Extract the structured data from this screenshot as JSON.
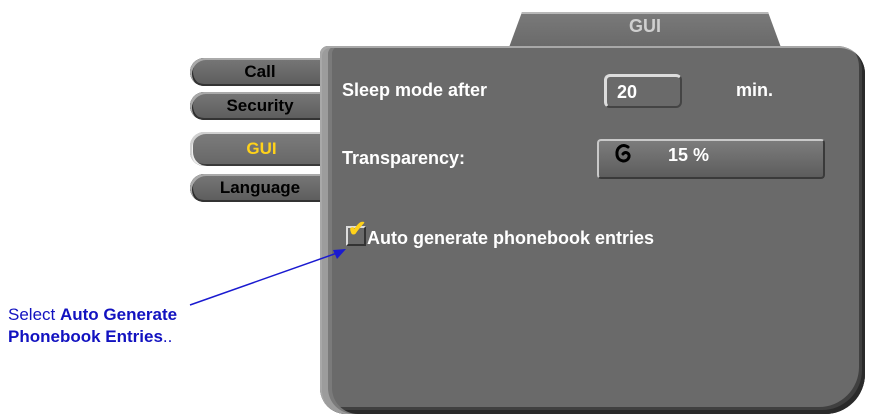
{
  "header": {
    "title": "GUI"
  },
  "sidebar": {
    "items": [
      {
        "label": "Call"
      },
      {
        "label": "Security"
      },
      {
        "label": "GUI"
      },
      {
        "label": "Language"
      }
    ],
    "active_index": 2
  },
  "settings": {
    "sleep_label": "Sleep mode after",
    "sleep_value": "20",
    "sleep_unit": "min.",
    "transparency_label": "Transparency:",
    "transparency_icon": "swirl-icon",
    "transparency_value": "15 %",
    "auto_generate_label": "Auto generate phonebook entries",
    "auto_generate_checked": true
  },
  "annotation": {
    "prefix": "Select ",
    "bold_line1": "Auto Generate",
    "bold_line2": "Phonebook Entries",
    "suffix": "."
  },
  "colors": {
    "panel": "#6a6a6a",
    "active_tab_text": "#ffd21a",
    "annotation_text": "#1212c0"
  }
}
